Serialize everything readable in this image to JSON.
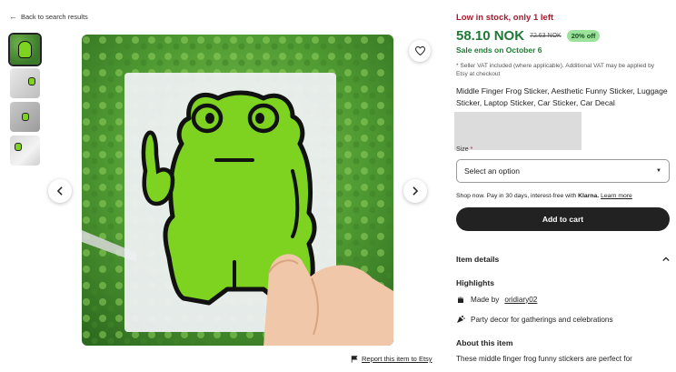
{
  "nav": {
    "back_label": "Back to search results"
  },
  "gallery": {
    "thumbnails": [
      "thumb-1",
      "thumb-2",
      "thumb-3",
      "thumb-4"
    ]
  },
  "report": {
    "label": "Report this item to Etsy"
  },
  "listing": {
    "stock_notice": "Low in stock, only 1 left",
    "price": "58.10 NOK",
    "original_price": "72.63 NOK",
    "discount": "20% off",
    "sale_ends": "Sale ends on October 6",
    "vat_note": "* Seller VAT included (where applicable). Additional VAT may be applied by Etsy at checkout",
    "title": "Middle Finger Frog Sticker, Aesthetic Funny Sticker, Luggage Sticker, Laptop Sticker, Car Sticker, Car Decal",
    "option_label": "Size",
    "option_required": "*",
    "select_placeholder": "Select an option",
    "klarna_pre": "Shop now. Pay in 30 days, interest-free with",
    "klarna_brand": "Klarna.",
    "klarna_link": "Learn more",
    "cart_label": "Add to cart"
  },
  "details": {
    "heading": "Item details",
    "highlights_heading": "Highlights",
    "made_by_prefix": "Made by",
    "shop_name": "oridiary02",
    "party_text": "Party decor for gatherings and celebrations",
    "about_heading": "About this item",
    "about_text": "These middle finger frog funny stickers are perfect for"
  },
  "colors": {
    "stock_red": "#a61a2e",
    "price_green": "#1e7a34",
    "discount_bg": "#9be39b",
    "button_dark": "#222222"
  }
}
